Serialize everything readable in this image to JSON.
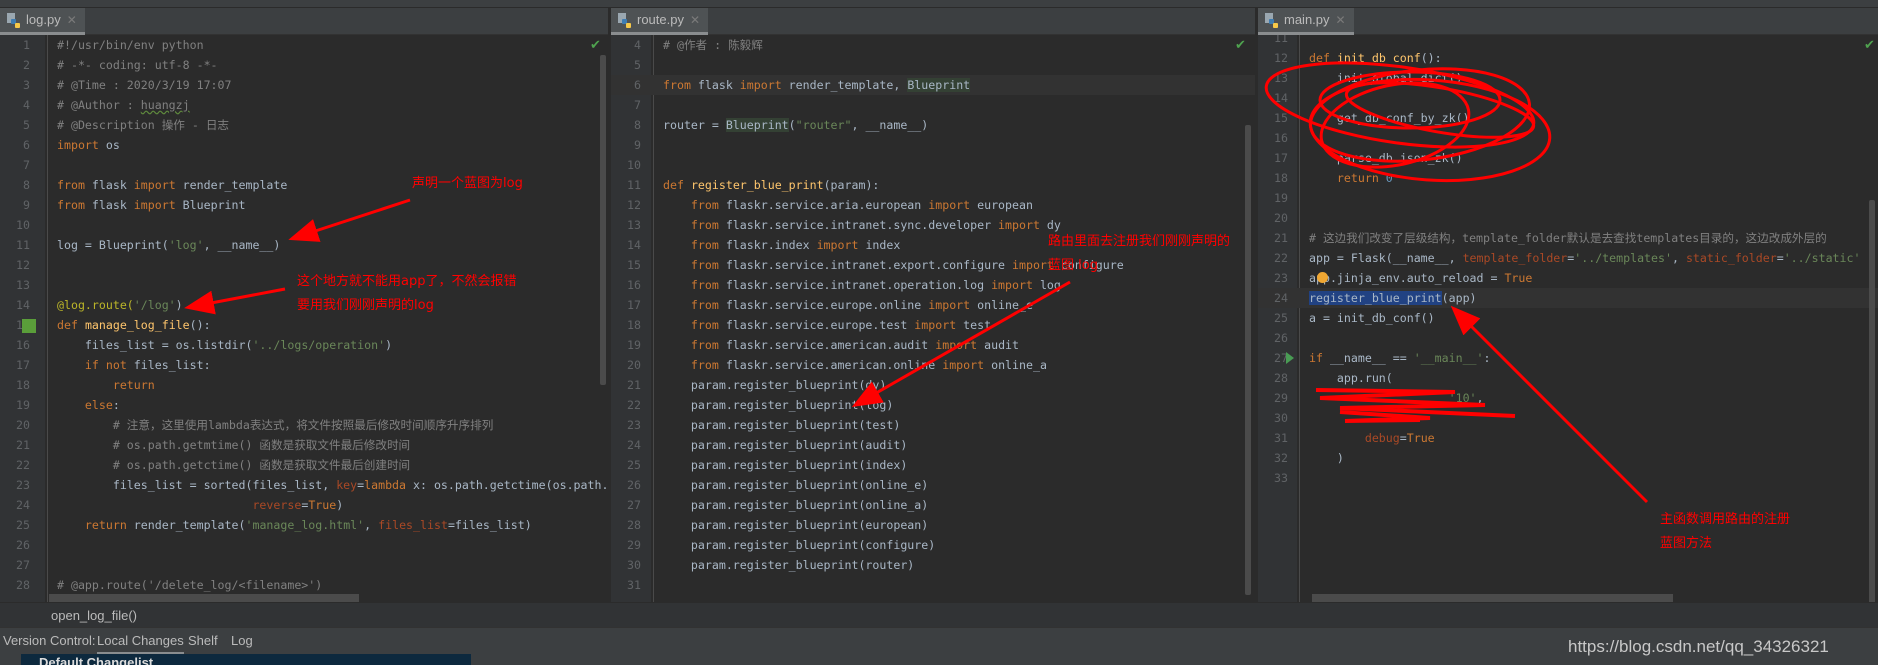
{
  "editors": [
    {
      "tab": "log.py",
      "lines": [
        {
          "n": "1",
          "t": [
            [
              "#!/usr/bin/env python",
              "cm"
            ]
          ]
        },
        {
          "n": "2",
          "t": [
            [
              "# -*- coding: utf-8 -*-",
              "cm"
            ]
          ]
        },
        {
          "n": "3",
          "t": [
            [
              "# @Time : 2020/3/19 17:07",
              "cm"
            ]
          ]
        },
        {
          "n": "4",
          "t": [
            [
              "# @Author : ",
              "cm"
            ],
            [
              "huangzj",
              "cm u"
            ]
          ]
        },
        {
          "n": "5",
          "t": [
            [
              "# @Description 操作 - 日志",
              "cm"
            ]
          ]
        },
        {
          "n": "6",
          "t": [
            [
              "import",
              "kw"
            ],
            [
              " os",
              ""
            ]
          ]
        },
        {
          "n": "7",
          "t": []
        },
        {
          "n": "8",
          "t": [
            [
              "from",
              "kw"
            ],
            [
              " flask ",
              ""
            ],
            [
              "import",
              "kw"
            ],
            [
              " render_template",
              ""
            ]
          ]
        },
        {
          "n": "9",
          "t": [
            [
              "from",
              "kw"
            ],
            [
              " flask ",
              ""
            ],
            [
              "import",
              "kw"
            ],
            [
              " Blueprint",
              ""
            ]
          ]
        },
        {
          "n": "10",
          "t": []
        },
        {
          "n": "11",
          "t": [
            [
              "log = Blueprint(",
              ""
            ],
            [
              "'log'",
              "str"
            ],
            [
              ", __name__)",
              ""
            ]
          ]
        },
        {
          "n": "12",
          "t": []
        },
        {
          "n": "13",
          "t": []
        },
        {
          "n": "14",
          "t": [
            [
              "@log.route(",
              "dec"
            ],
            [
              "'/log'",
              "str"
            ],
            [
              ")",
              ""
            ]
          ]
        },
        {
          "n": "15",
          "t": [
            [
              "def",
              "kw"
            ],
            [
              " ",
              ""
            ],
            [
              "manage_log_file",
              "fn"
            ],
            [
              "():",
              ""
            ]
          ]
        },
        {
          "n": "16",
          "t": [
            [
              "    files_list = os.listdir(",
              ""
            ],
            [
              "'../logs/operation'",
              "str"
            ],
            [
              ")",
              ""
            ]
          ]
        },
        {
          "n": "17",
          "t": [
            [
              "    ",
              ""
            ],
            [
              "if not",
              "kw"
            ],
            [
              " files_list:",
              ""
            ]
          ]
        },
        {
          "n": "18",
          "t": [
            [
              "        ",
              ""
            ],
            [
              "return",
              "kw"
            ]
          ]
        },
        {
          "n": "19",
          "t": [
            [
              "    ",
              ""
            ],
            [
              "else",
              "kw"
            ],
            [
              ":",
              ""
            ]
          ]
        },
        {
          "n": "20",
          "t": [
            [
              "        # 注意，这里使用lambda表达式，将文件按照最后修改时间顺序升序排列",
              "cm"
            ]
          ]
        },
        {
          "n": "21",
          "t": [
            [
              "        # os.path.getmtime() 函数是获取文件最后修改时间",
              "cm"
            ]
          ]
        },
        {
          "n": "22",
          "t": [
            [
              "        # os.path.getctime() 函数是获取文件最后创建时间",
              "cm"
            ]
          ]
        },
        {
          "n": "23",
          "t": [
            [
              "        files_list = sorted(files_list, ",
              ""
            ],
            [
              "key",
              "param"
            ],
            [
              "=",
              ""
            ],
            [
              "lambda",
              "kw"
            ],
            [
              " x: os.path.getctime(os.path.",
              ""
            ]
          ]
        },
        {
          "n": "24",
          "t": [
            [
              "                            ",
              ""
            ],
            [
              "reverse",
              "param"
            ],
            [
              "=",
              ""
            ],
            [
              "True",
              "kw"
            ],
            [
              ")",
              ""
            ]
          ]
        },
        {
          "n": "25",
          "t": [
            [
              "    ",
              ""
            ],
            [
              "return",
              "kw"
            ],
            [
              " render_template(",
              ""
            ],
            [
              "'manage_log.html'",
              "str"
            ],
            [
              ", ",
              ""
            ],
            [
              "files_list",
              "param"
            ],
            [
              "=files_list)",
              ""
            ]
          ]
        },
        {
          "n": "26",
          "t": []
        },
        {
          "n": "27",
          "t": []
        },
        {
          "n": "28",
          "t": [
            [
              "# @app.route('/delete_log/<filename>')",
              "cm"
            ]
          ]
        }
      ]
    },
    {
      "tab": "route.py",
      "lines": [
        {
          "n": "4",
          "t": [
            [
              "# @作者 : 陈毅辉",
              "cm"
            ]
          ]
        },
        {
          "n": "5",
          "t": []
        },
        {
          "n": "6",
          "t": [
            [
              "from",
              "kw"
            ],
            [
              " flask ",
              ""
            ],
            [
              "import",
              "kw"
            ],
            [
              " render_template, ",
              ""
            ],
            [
              "Blueprint",
              "hl"
            ]
          ]
        },
        {
          "n": "7",
          "t": []
        },
        {
          "n": "8",
          "t": [
            [
              "router = ",
              ""
            ],
            [
              "Blueprint",
              "hl"
            ],
            [
              "(",
              ""
            ],
            [
              "\"router\"",
              "str"
            ],
            [
              ", __name__)",
              ""
            ]
          ]
        },
        {
          "n": "9",
          "t": []
        },
        {
          "n": "10",
          "t": []
        },
        {
          "n": "11",
          "t": [
            [
              "def",
              "kw"
            ],
            [
              " ",
              ""
            ],
            [
              "register_blue_print",
              "fn"
            ],
            [
              "(param):",
              ""
            ]
          ]
        },
        {
          "n": "12",
          "t": [
            [
              "    ",
              ""
            ],
            [
              "from",
              "kw"
            ],
            [
              " flaskr.service.aria.european ",
              ""
            ],
            [
              "import",
              "kw"
            ],
            [
              " european",
              ""
            ]
          ]
        },
        {
          "n": "13",
          "t": [
            [
              "    ",
              ""
            ],
            [
              "from",
              "kw"
            ],
            [
              " flaskr.service.intranet.sync.developer ",
              ""
            ],
            [
              "import",
              "kw"
            ],
            [
              " dy",
              ""
            ]
          ]
        },
        {
          "n": "14",
          "t": [
            [
              "    ",
              ""
            ],
            [
              "from",
              "kw"
            ],
            [
              " flaskr.index ",
              ""
            ],
            [
              "import",
              "kw"
            ],
            [
              " index",
              ""
            ]
          ]
        },
        {
          "n": "15",
          "t": [
            [
              "    ",
              ""
            ],
            [
              "from",
              "kw"
            ],
            [
              " flaskr.service.intranet.export.configure ",
              ""
            ],
            [
              "import",
              "kw"
            ],
            [
              " configure",
              ""
            ]
          ]
        },
        {
          "n": "16",
          "t": [
            [
              "    ",
              ""
            ],
            [
              "from",
              "kw"
            ],
            [
              " flaskr.service.intranet.operation.log ",
              ""
            ],
            [
              "import",
              "kw"
            ],
            [
              " log",
              ""
            ]
          ]
        },
        {
          "n": "17",
          "t": [
            [
              "    ",
              ""
            ],
            [
              "from",
              "kw"
            ],
            [
              " flaskr.service.europe.online ",
              ""
            ],
            [
              "import",
              "kw"
            ],
            [
              " online_e",
              ""
            ]
          ]
        },
        {
          "n": "18",
          "t": [
            [
              "    ",
              ""
            ],
            [
              "from",
              "kw"
            ],
            [
              " flaskr.service.europe.test ",
              ""
            ],
            [
              "import",
              "kw"
            ],
            [
              " test",
              ""
            ]
          ]
        },
        {
          "n": "19",
          "t": [
            [
              "    ",
              ""
            ],
            [
              "from",
              "kw"
            ],
            [
              " flaskr.service.american.audit ",
              ""
            ],
            [
              "import",
              "kw"
            ],
            [
              " audit",
              ""
            ]
          ]
        },
        {
          "n": "20",
          "t": [
            [
              "    ",
              ""
            ],
            [
              "from",
              "kw"
            ],
            [
              " flaskr.service.american.online ",
              ""
            ],
            [
              "import",
              "kw"
            ],
            [
              " online_a",
              ""
            ]
          ]
        },
        {
          "n": "21",
          "t": [
            [
              "    param.register_blueprint(dy)",
              ""
            ]
          ]
        },
        {
          "n": "22",
          "t": [
            [
              "    param.register_blueprint(log)",
              ""
            ]
          ]
        },
        {
          "n": "23",
          "t": [
            [
              "    param.register_blueprint(test)",
              ""
            ]
          ]
        },
        {
          "n": "24",
          "t": [
            [
              "    param.register_blueprint(audit)",
              ""
            ]
          ]
        },
        {
          "n": "25",
          "t": [
            [
              "    param.register_blueprint(index)",
              ""
            ]
          ]
        },
        {
          "n": "26",
          "t": [
            [
              "    param.register_blueprint(online_e)",
              ""
            ]
          ]
        },
        {
          "n": "27",
          "t": [
            [
              "    param.register_blueprint(online_a)",
              ""
            ]
          ]
        },
        {
          "n": "28",
          "t": [
            [
              "    param.register_blueprint(european)",
              ""
            ]
          ]
        },
        {
          "n": "29",
          "t": [
            [
              "    param.register_blueprint(configure)",
              ""
            ]
          ]
        },
        {
          "n": "30",
          "t": [
            [
              "    param.register_blueprint(router)",
              ""
            ]
          ]
        },
        {
          "n": "31",
          "t": []
        }
      ]
    },
    {
      "tab": "main.py",
      "lines": [
        {
          "n": "11",
          "t": []
        },
        {
          "n": "12",
          "t": [
            [
              "def",
              "kw"
            ],
            [
              " ",
              ""
            ],
            [
              "init_db_conf",
              "fn"
            ],
            [
              "():",
              ""
            ]
          ]
        },
        {
          "n": "13",
          "t": [
            [
              "    init_global_dict()",
              ""
            ]
          ]
        },
        {
          "n": "14",
          "t": []
        },
        {
          "n": "15",
          "t": [
            [
              "    get_db_conf_by_zk()",
              ""
            ]
          ]
        },
        {
          "n": "16",
          "t": []
        },
        {
          "n": "17",
          "t": [
            [
              "    parse_db_json_zk()",
              ""
            ]
          ]
        },
        {
          "n": "18",
          "t": [
            [
              "    ",
              ""
            ],
            [
              "return",
              "kw"
            ],
            [
              " ",
              ""
            ],
            [
              "0",
              "num"
            ]
          ]
        },
        {
          "n": "19",
          "t": []
        },
        {
          "n": "20",
          "t": []
        },
        {
          "n": "21",
          "t": [
            [
              "# 这边我们改变了层级结构，template_folder默认是去查找templates目录的，这边改成外层的",
              "cm"
            ]
          ]
        },
        {
          "n": "22",
          "t": [
            [
              "app = Flask(__name__, ",
              ""
            ],
            [
              "template_folder",
              "param"
            ],
            [
              "=",
              ""
            ],
            [
              "'../templates'",
              "str"
            ],
            [
              ", ",
              ""
            ],
            [
              "static_folder",
              "param"
            ],
            [
              "=",
              ""
            ],
            [
              "'../static'",
              "str"
            ]
          ]
        },
        {
          "n": "23",
          "t": [
            [
              "app.jinja_env.auto_reload = ",
              ""
            ],
            [
              "True",
              "kw"
            ]
          ]
        },
        {
          "n": "24",
          "t": [
            [
              "register_blue_print",
              "sel"
            ],
            [
              "(app)",
              ""
            ]
          ]
        },
        {
          "n": "25",
          "t": [
            [
              "a = init_db_conf()",
              ""
            ]
          ]
        },
        {
          "n": "26",
          "t": []
        },
        {
          "n": "27",
          "t": [
            [
              "if",
              "kw"
            ],
            [
              " __name__ == ",
              ""
            ],
            [
              "'__main__'",
              "str"
            ],
            [
              ":",
              ""
            ]
          ]
        },
        {
          "n": "28",
          "t": [
            [
              "    app.run(",
              ""
            ]
          ]
        },
        {
          "n": "29",
          "t": [
            [
              "                    ",
              ""
            ],
            [
              "'10'",
              "str"
            ],
            [
              ",",
              ""
            ]
          ]
        },
        {
          "n": "30",
          "t": []
        },
        {
          "n": "31",
          "t": [
            [
              "        ",
              ""
            ],
            [
              "debug",
              "param"
            ],
            [
              "=",
              ""
            ],
            [
              "True",
              "kw"
            ]
          ]
        },
        {
          "n": "32",
          "t": [
            [
              "    )",
              ""
            ]
          ]
        },
        {
          "n": "33",
          "t": []
        }
      ]
    }
  ],
  "annotations": {
    "log_blueprint": "声明一个蓝图为log",
    "no_app_line1": "这个地方就不能用app了，不然会报错",
    "no_app_line2": "要用我们刚刚声明的log",
    "route_line1": "路由里面去注册我们刚刚声明的",
    "route_line2": "蓝图 log",
    "main_line1": "主函数调用路由的注册",
    "main_line2": "蓝图方法",
    "color": "#ff0000"
  },
  "breadcrumb": "open_log_file()",
  "version_control": {
    "label": "Version Control:",
    "tabs": [
      "Local Changes",
      "Shelf",
      "Log"
    ],
    "active_tab": "Local Changes",
    "changelist": "Default Changelist"
  },
  "watermark": "https://blog.csdn.net/qq_34326321"
}
